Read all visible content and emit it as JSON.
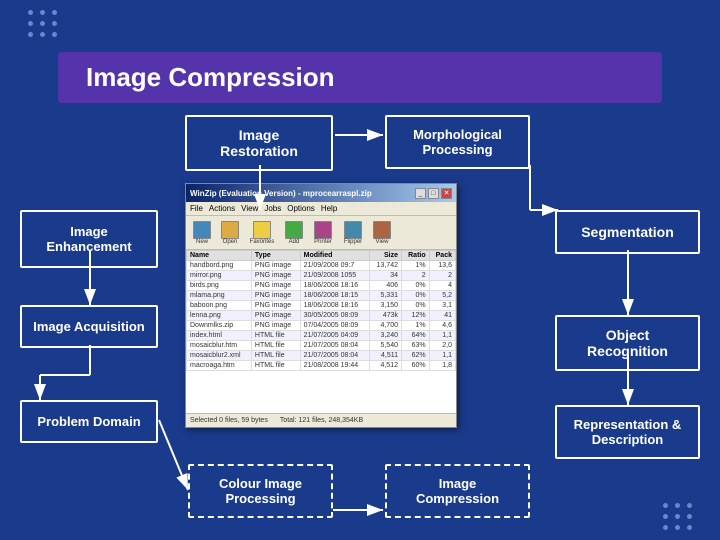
{
  "page": {
    "background_color": "#1a3a8c",
    "title": "Image Compression"
  },
  "header": {
    "title": "Image Compression",
    "bg_color": "#5533aa"
  },
  "boxes": {
    "image_restoration": "Image Restoration",
    "morphological_processing": "Morphological Processing",
    "image_enhancement": "Image Enhancement",
    "image_acquisition": "Image Acquisition",
    "problem_domain": "Problem Domain",
    "segmentation": "Segmentation",
    "object_recognition": "Object Recognition",
    "representation_description": "Representation & Description",
    "colour_image_processing": "Colour Image Processing",
    "image_compression": "Image Compression"
  },
  "screenshot": {
    "title": "WinZip (Evaluation Version) - mprocearraspl.zip",
    "menu_items": [
      "File",
      "Actions",
      "View",
      "Jobs",
      "Options",
      "Help"
    ],
    "toolbar_buttons": [
      "New",
      "Open",
      "Favorites",
      "Add",
      "Printer",
      "Flipper",
      "View"
    ],
    "columns": [
      "Name",
      "Type",
      "Modified",
      "Size",
      "Ratio",
      "Pack"
    ],
    "rows": [
      [
        "handbord.png",
        "PNG image",
        "21/09/2008 09:7",
        "13,742",
        "1%",
        "13,6"
      ],
      [
        "mirror.png",
        "PNG image",
        "21/09/2008 1055",
        "34",
        "2",
        "2"
      ],
      [
        "birds.png",
        "PNG image",
        "18/06/2008 18:16",
        "406",
        "0%",
        "4"
      ],
      [
        "mlama.png",
        "PNG image",
        "18/06/2008 18:15",
        "5,331",
        "0%",
        "5,2"
      ],
      [
        "baboon.png",
        "PNG image",
        "18/06/2008 18:16",
        "3,150",
        "0%",
        "3,1"
      ],
      [
        "lenna.png",
        "PNG image",
        "30/05/2005 08:09",
        "473k",
        "12%",
        "41"
      ],
      [
        "Downmlks.zip",
        "PNG image",
        "07/04/2005 08:09",
        "4,700",
        "1%",
        "4,6"
      ],
      [
        "index.html",
        "HTML file",
        "21/07/2005 04:09",
        "3,240",
        "64%",
        "1,1"
      ],
      [
        "mosaicblur.htm",
        "HTML file",
        "21/07/2005 08:04",
        "5,540",
        "63%",
        "2,0"
      ],
      [
        "mosaicblur2.xml",
        "HTML file",
        "21/07/2005 08:04",
        "4,511",
        "62%",
        "1,1"
      ],
      [
        "macroaga.htm",
        "HTML file",
        "21/08/2008 19:44",
        "4,512",
        "60%",
        "1,8"
      ]
    ],
    "status": "Selected 0 files, 59 bytes",
    "total": "Total: 121 files, 248,354KB"
  }
}
